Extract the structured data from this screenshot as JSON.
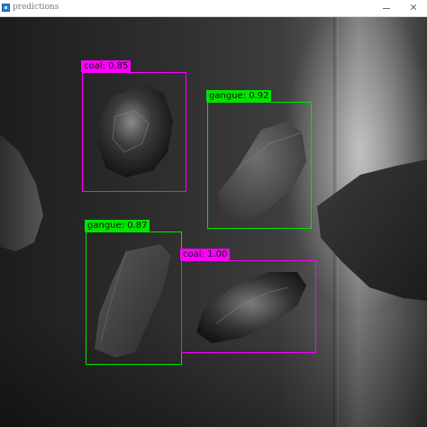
{
  "window": {
    "title": "predictions",
    "minimize_glyph": "",
    "close_glyph": "✕"
  },
  "colors": {
    "coal": "#ff00ff",
    "gangue": "#00e400"
  },
  "detections": [
    {
      "label": "coal: 0.85",
      "class": "coal",
      "confidence": 0.85
    },
    {
      "label": "gangue: 0.92",
      "class": "gangue",
      "confidence": 0.92
    },
    {
      "label": "gangue: 0.87",
      "class": "gangue",
      "confidence": 0.87
    },
    {
      "label": "coal: 1.00",
      "class": "coal",
      "confidence": 1.0
    }
  ]
}
